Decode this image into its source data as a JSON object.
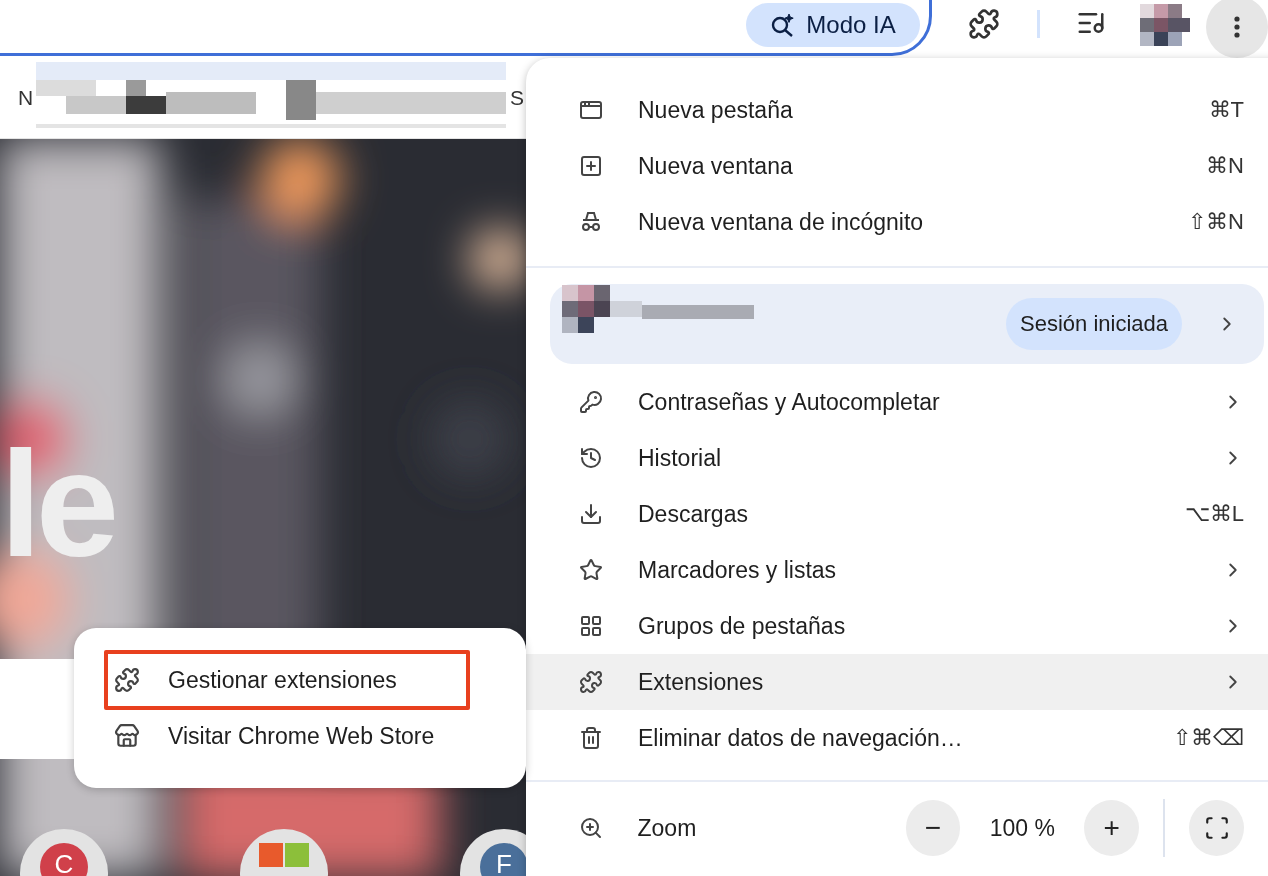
{
  "toolbar": {
    "ai_button": "Modo IA"
  },
  "bookmarks_bar": {
    "edge_texts": [
      "N",
      "S"
    ]
  },
  "new_tab_page": {
    "logo_text": "le",
    "shortcuts": [
      {
        "kind": "letter",
        "letter": "C",
        "color": "#d0404a"
      },
      {
        "kind": "tiles"
      },
      {
        "kind": "letter",
        "letter": "F",
        "color": "#4a6f9a"
      }
    ]
  },
  "menu": {
    "top_items": [
      {
        "label": "Nueva pestaña",
        "shortcut": "⌘T"
      },
      {
        "label": "Nueva ventana",
        "shortcut": "⌘N"
      },
      {
        "label": "Nueva ventana de incógnito",
        "shortcut": "⇧⌘N"
      }
    ],
    "profile": {
      "status": "Sesión iniciada"
    },
    "items": [
      {
        "label": "Contraseñas y Autocompletar",
        "submenu": true,
        "selected": false
      },
      {
        "label": "Historial",
        "submenu": true,
        "selected": false
      },
      {
        "label": "Descargas",
        "shortcut": "⌥⌘L",
        "submenu": false,
        "selected": false
      },
      {
        "label": "Marcadores y listas",
        "submenu": true,
        "selected": false
      },
      {
        "label": "Grupos de pestañas",
        "submenu": true,
        "selected": false
      },
      {
        "label": "Extensiones",
        "submenu": true,
        "selected": true
      },
      {
        "label": "Eliminar datos de navegación…",
        "shortcut": "⇧⌘⌫",
        "submenu": false,
        "selected": false
      }
    ],
    "zoom": {
      "label": "Zoom",
      "minus": "−",
      "value": "100 %",
      "plus": "+"
    }
  },
  "submenu": {
    "items": [
      {
        "label": "Gestionar extensiones",
        "annotated": true
      },
      {
        "label": "Visitar Chrome Web Store",
        "annotated": false
      }
    ]
  }
}
